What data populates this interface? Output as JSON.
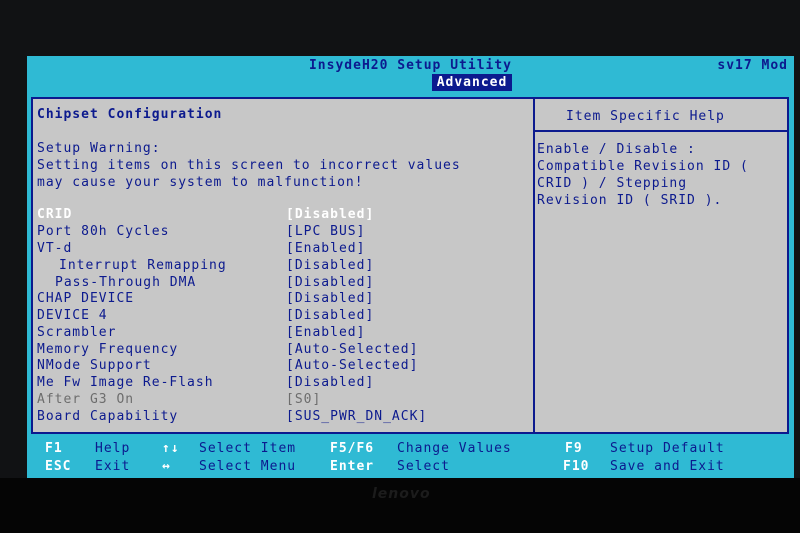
{
  "header": {
    "title": "InsydeH20 Setup Utility",
    "model": "sv17 Mod",
    "active_tab": "Advanced"
  },
  "panel": {
    "heading": "Chipset Configuration",
    "warning_title": "Setup Warning:",
    "warning_line1": "Setting items on this screen to incorrect values",
    "warning_line2": "may cause your system to malfunction!"
  },
  "settings": [
    {
      "label": "CRID",
      "value": "[Disabled]"
    },
    {
      "label": "Port 80h Cycles",
      "value": "[LPC BUS]"
    },
    {
      "label": "VT-d",
      "value": "[Enabled]"
    },
    {
      "label": "Interrupt Remapping",
      "value": "[Disabled]"
    },
    {
      "label": "Pass-Through DMA",
      "value": "[Disabled]"
    },
    {
      "label": "CHAP DEVICE",
      "value": "[Disabled]"
    },
    {
      "label": "DEVICE 4",
      "value": "[Disabled]"
    },
    {
      "label": "Scrambler",
      "value": "[Enabled]"
    },
    {
      "label": "Memory Frequency",
      "value": "[Auto-Selected]"
    },
    {
      "label": "NMode Support",
      "value": "[Auto-Selected]"
    },
    {
      "label": "Me Fw Image Re-Flash",
      "value": "[Disabled]"
    },
    {
      "label": "After G3 On",
      "value": "[S0]"
    },
    {
      "label": "Board Capability",
      "value": "[SUS_PWR_DN_ACK]"
    }
  ],
  "help": {
    "heading": "Item Specific Help",
    "line1": "Enable / Disable :",
    "line2": "Compatible Revision ID (",
    "line3": "CRID ) / Stepping",
    "line4": "Revision ID ( SRID )."
  },
  "footer": {
    "f1_key": "F1",
    "f1_desc": "Help",
    "updown_key": "↑↓",
    "updown_desc": "Select Item",
    "f5f6_key": "F5/F6",
    "f5f6_desc": "Change Values",
    "f9_key": "F9",
    "f9_desc": "Setup Default",
    "esc_key": "ESC",
    "esc_desc": "Exit",
    "leftright_key": "↔",
    "leftright_desc": "Select Menu",
    "enter_key": "Enter",
    "enter_desc": "Select",
    "f10_key": "F10",
    "f10_desc": "Save and Exit"
  },
  "bezel": {
    "brand": "lenovo"
  },
  "colors": {
    "cyan": "#2fbad4",
    "panel_gray": "#c7c7c7",
    "navy": "#0c1a8e",
    "highlight": "#ffffff"
  }
}
